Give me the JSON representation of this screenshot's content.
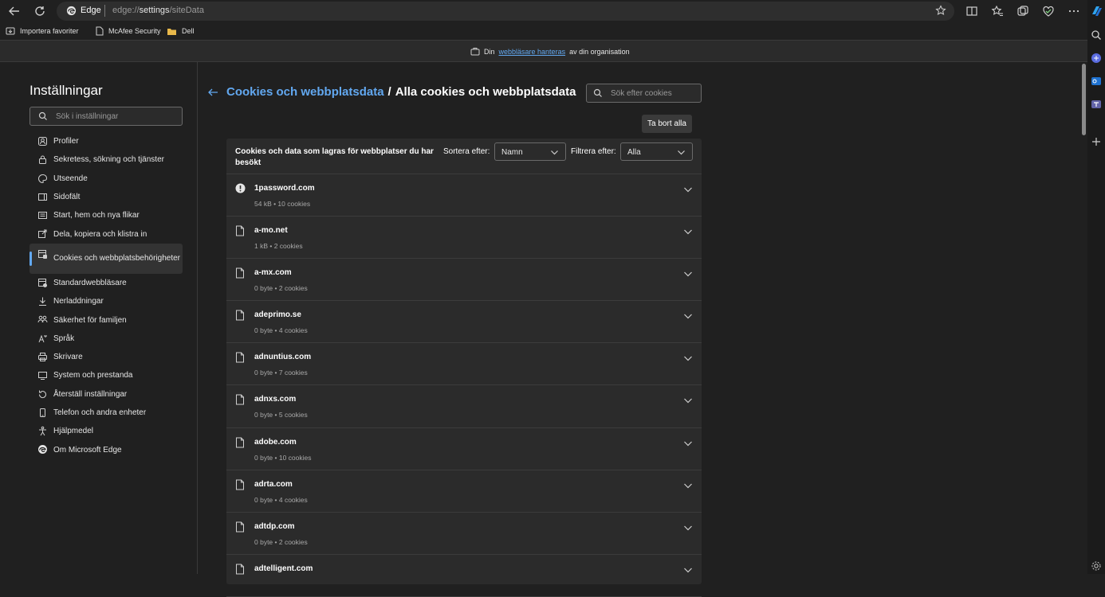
{
  "browser": {
    "brand": "Edge",
    "url_prefix": "edge://",
    "url_host": "settings",
    "url_path": "/siteData"
  },
  "favorites": [
    {
      "label": "Importera favoriter",
      "icon": "import-icon"
    },
    {
      "label": "McAfee Security",
      "icon": "page-icon"
    },
    {
      "label": "Dell",
      "icon": "folder-icon"
    }
  ],
  "banner": {
    "prefix": "Din",
    "link": "webbläsare hanteras",
    "suffix": "av din organisation"
  },
  "sidebar": {
    "title": "Inställningar",
    "search_placeholder": "Sök i inställningar",
    "items": [
      {
        "label": "Profiler",
        "icon": "profile-icon"
      },
      {
        "label": "Sekretess, sökning och tjänster",
        "icon": "lock-icon"
      },
      {
        "label": "Utseende",
        "icon": "appearance-icon"
      },
      {
        "label": "Sidofält",
        "icon": "sidebar-icon"
      },
      {
        "label": "Start, hem och nya flikar",
        "icon": "home-icon"
      },
      {
        "label": "Dela, kopiera och klistra in",
        "icon": "share-icon"
      },
      {
        "label": "Cookies och webbplatsbehörigheter",
        "icon": "cookie-permissions-icon",
        "active": true
      },
      {
        "label": "Standardwebbläsare",
        "icon": "default-browser-icon"
      },
      {
        "label": "Nerladdningar",
        "icon": "download-icon"
      },
      {
        "label": "Säkerhet för familjen",
        "icon": "family-icon"
      },
      {
        "label": "Språk",
        "icon": "language-icon"
      },
      {
        "label": "Skrivare",
        "icon": "printer-icon"
      },
      {
        "label": "System och prestanda",
        "icon": "system-icon"
      },
      {
        "label": "Återställ inställningar",
        "icon": "reset-icon"
      },
      {
        "label": "Telefon och andra enheter",
        "icon": "phone-icon"
      },
      {
        "label": "Hjälpmedel",
        "icon": "accessibility-icon"
      },
      {
        "label": "Om Microsoft Edge",
        "icon": "edge-logo-icon"
      }
    ]
  },
  "main": {
    "breadcrumb_link": "Cookies och webbplatsdata",
    "breadcrumb_sep": "/",
    "breadcrumb_current": "Alla cookies och webbplatsdata",
    "search_placeholder": "Sök efter cookies",
    "remove_all": "Ta bort alla",
    "panel_desc": "Cookies och data som lagras för webbplatser du har besökt",
    "sort_label": "Sortera efter:",
    "sort_value": "Namn",
    "filter_label": "Filtrera efter:",
    "filter_value": "Alla",
    "sites": [
      {
        "name": "1password.com",
        "meta": "54 kB • 10 cookies",
        "icon": "info-icon"
      },
      {
        "name": "a-mo.net",
        "meta": "1 kB • 2 cookies",
        "icon": "page-icon"
      },
      {
        "name": "a-mx.com",
        "meta": "0 byte • 2 cookies",
        "icon": "page-icon"
      },
      {
        "name": "adeprimo.se",
        "meta": "0 byte • 4 cookies",
        "icon": "page-icon"
      },
      {
        "name": "adnuntius.com",
        "meta": "0 byte • 7 cookies",
        "icon": "page-icon"
      },
      {
        "name": "adnxs.com",
        "meta": "0 byte • 5 cookies",
        "icon": "page-icon"
      },
      {
        "name": "adobe.com",
        "meta": "0 byte • 10 cookies",
        "icon": "page-icon"
      },
      {
        "name": "adrta.com",
        "meta": "0 byte • 4 cookies",
        "icon": "page-icon"
      },
      {
        "name": "adtdp.com",
        "meta": "0 byte • 2 cookies",
        "icon": "page-icon"
      },
      {
        "name": "adtelligent.com",
        "meta": "",
        "icon": "page-icon"
      }
    ]
  },
  "colors": {
    "background": "#202020",
    "panel": "#2b2b2b",
    "accent": "#62a8f0"
  }
}
